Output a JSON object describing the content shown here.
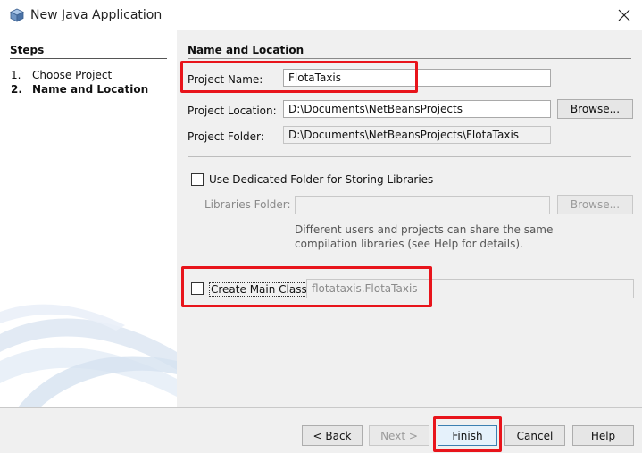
{
  "window": {
    "title": "New Java Application",
    "app_icon": "netbeans-cube-icon",
    "close_icon": "close-x-icon"
  },
  "steps": {
    "heading": "Steps",
    "items": [
      {
        "num": "1.",
        "label": "Choose Project",
        "active": false
      },
      {
        "num": "2.",
        "label": "Name and Location",
        "active": true
      }
    ]
  },
  "form": {
    "heading": "Name and Location",
    "project_name": {
      "label": "Project Name:",
      "value": "FlotaTaxis"
    },
    "project_location": {
      "label": "Project Location:",
      "value": "D:\\Documents\\NetBeansProjects",
      "browse": "Browse..."
    },
    "project_folder": {
      "label": "Project Folder:",
      "value": "D:\\Documents\\NetBeansProjects\\FlotaTaxis"
    },
    "dedicated_folder": {
      "label": "Use Dedicated Folder for Storing Libraries",
      "checked": false
    },
    "libraries_folder": {
      "label": "Libraries Folder:",
      "value": "",
      "browse": "Browse..."
    },
    "hint_line1": "Different users and projects can share the same",
    "hint_line2": "compilation libraries (see Help for details).",
    "main_class": {
      "label": "Create Main Class",
      "checked": false,
      "value": "flotataxis.FlotaTaxis"
    }
  },
  "buttons": {
    "back": "< Back",
    "next": "Next >",
    "finish": "Finish",
    "cancel": "Cancel",
    "help": "Help"
  },
  "colors": {
    "highlight": "#e8141b",
    "pane_background": "#f0f0f0"
  }
}
